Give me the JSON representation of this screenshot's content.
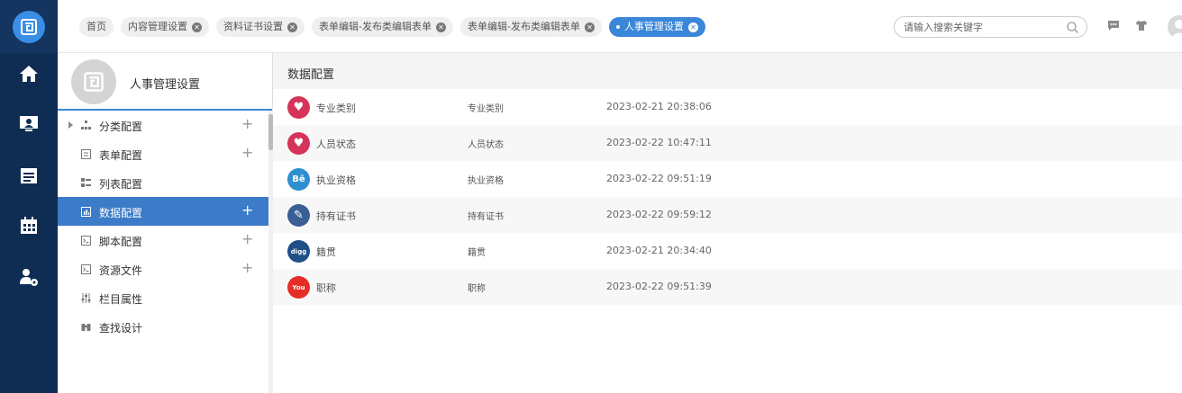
{
  "tabs": [
    {
      "label": "首页",
      "closable": false,
      "active": false
    },
    {
      "label": "内容管理设置",
      "closable": true,
      "active": false
    },
    {
      "label": "资料证书设置",
      "closable": true,
      "active": false
    },
    {
      "label": "表单编辑-发布类编辑表单",
      "closable": true,
      "active": false
    },
    {
      "label": "表单编辑-发布类编辑表单",
      "closable": true,
      "active": false
    },
    {
      "label": "人事管理设置",
      "closable": true,
      "active": true
    }
  ],
  "search": {
    "placeholder": "请输入搜索关键字"
  },
  "sidebar": {
    "title": "人事管理设置",
    "items": [
      {
        "label": "分类配置",
        "icon": "tree-structure-icon",
        "has_arrow": true,
        "plus": true,
        "active": false
      },
      {
        "label": "表单配置",
        "icon": "form-icon",
        "has_arrow": false,
        "plus": true,
        "active": false
      },
      {
        "label": "列表配置",
        "icon": "list-icon",
        "has_arrow": false,
        "plus": false,
        "active": false
      },
      {
        "label": "数据配置",
        "icon": "chart-icon",
        "has_arrow": false,
        "plus": true,
        "active": true
      },
      {
        "label": "脚本配置",
        "icon": "terminal-icon",
        "has_arrow": false,
        "plus": true,
        "active": false
      },
      {
        "label": "资源文件",
        "icon": "terminal-icon",
        "has_arrow": false,
        "plus": true,
        "active": false
      },
      {
        "label": "栏目属性",
        "icon": "sliders-icon",
        "has_arrow": false,
        "plus": false,
        "active": false
      },
      {
        "label": "查找设计",
        "icon": "binoculars-icon",
        "has_arrow": false,
        "plus": false,
        "active": false
      }
    ]
  },
  "content": {
    "title": "数据配置",
    "rows": [
      {
        "name": "专业类别",
        "code": "专业类别",
        "time": "2023-02-21 20:38:06",
        "icon": "heart-icon",
        "color": "#d6335a",
        "glyph": "♥"
      },
      {
        "name": "人员状态",
        "code": "人员状态",
        "time": "2023-02-22 10:47:11",
        "icon": "heart-icon",
        "color": "#d6335a",
        "glyph": "♥"
      },
      {
        "name": "执业资格",
        "code": "执业资格",
        "time": "2023-02-22 09:51:19",
        "icon": "behance-icon",
        "color": "#2d8fd0",
        "glyph": "Bē"
      },
      {
        "name": "持有证书",
        "code": "持有证书",
        "time": "2023-02-22 09:59:12",
        "icon": "paperclip-icon",
        "color": "#3a5f97",
        "glyph": "✎"
      },
      {
        "name": "籍贯",
        "code": "籍贯",
        "time": "2023-02-21 20:34:40",
        "icon": "digg-icon",
        "color": "#1e4f86",
        "glyph": "digg"
      },
      {
        "name": "职称",
        "code": "职称",
        "time": "2023-02-22 09:51:39",
        "icon": "youtube-icon",
        "color": "#e52d27",
        "glyph": "You"
      }
    ]
  },
  "colors": {
    "rail": "#0f2d52",
    "accent": "#3a86d8",
    "active_item": "#3c7bc7"
  }
}
